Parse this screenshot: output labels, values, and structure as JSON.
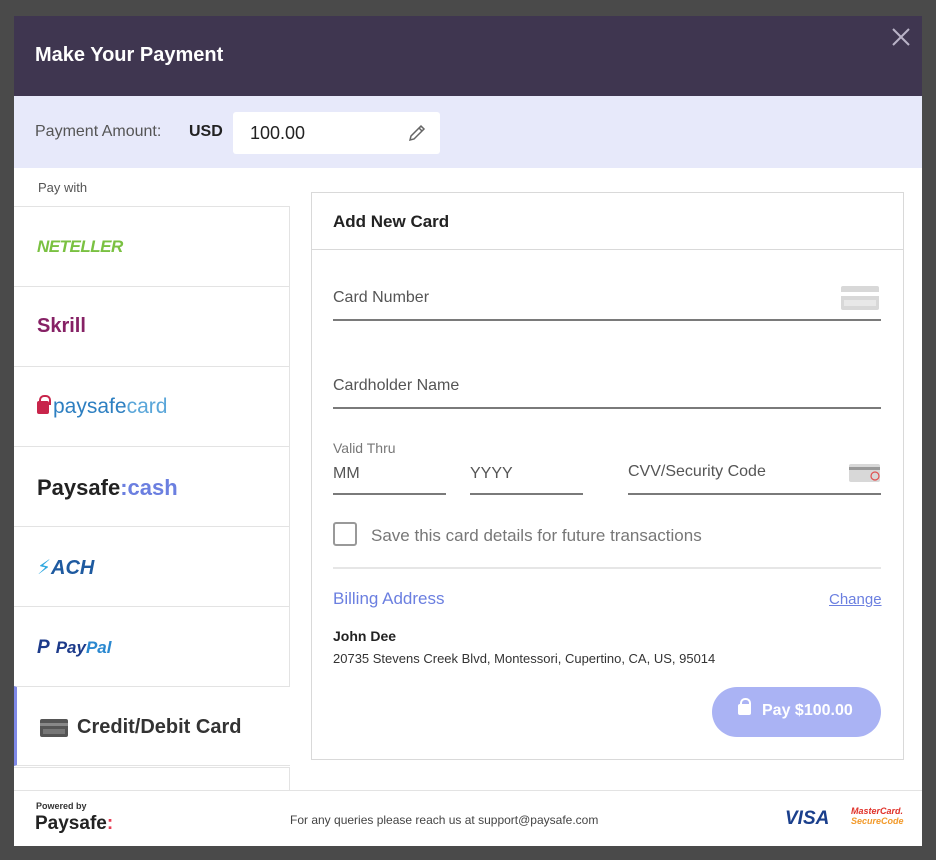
{
  "header": {
    "title": "Make Your Payment"
  },
  "amount": {
    "label": "Payment Amount:",
    "currency": "USD",
    "value": "100.00"
  },
  "sidebar": {
    "heading": "Pay with",
    "methods": [
      {
        "id": "neteller",
        "label": "NETELLER"
      },
      {
        "id": "skrill",
        "label": "Skrill"
      },
      {
        "id": "paysafecard",
        "label_a": "paysafe",
        "label_b": "card"
      },
      {
        "id": "paysafecash",
        "label_a": "Paysafe",
        "label_b": ":cash"
      },
      {
        "id": "ach",
        "label": "ACH"
      },
      {
        "id": "paypal",
        "label_a": "Pay",
        "label_b": "Pal"
      }
    ],
    "active": {
      "label": "Credit/Debit Card"
    }
  },
  "form": {
    "title": "Add New Card",
    "card_number": "Card Number",
    "cardholder_name": "Cardholder Name",
    "valid_thru": "Valid Thru",
    "month": "MM",
    "year": "YYYY",
    "cvv": "CVV/Security Code",
    "save_card": "Save this card details for future transactions",
    "save_card_checked": false
  },
  "billing": {
    "title": "Billing Address",
    "change": "Change",
    "name": "John Dee",
    "address": "20735 Stevens Creek Blvd, Montessori, Cupertino, CA, US, 95014"
  },
  "pay_button": {
    "label": "Pay $100.00"
  },
  "footer": {
    "powered_by": "Powered by",
    "brand": "Paysafe",
    "brand_colon": ":",
    "support": "For any queries please reach us at support@paysafe.com",
    "visa": "VISA",
    "mastercard_a": "MasterCard.",
    "mastercard_b": "SecureCode"
  },
  "colors": {
    "header_bg": "#3f3650",
    "amount_bg": "#e7e9fa",
    "accent": "#6b7fe0",
    "pay_button": "#aab3f4"
  }
}
